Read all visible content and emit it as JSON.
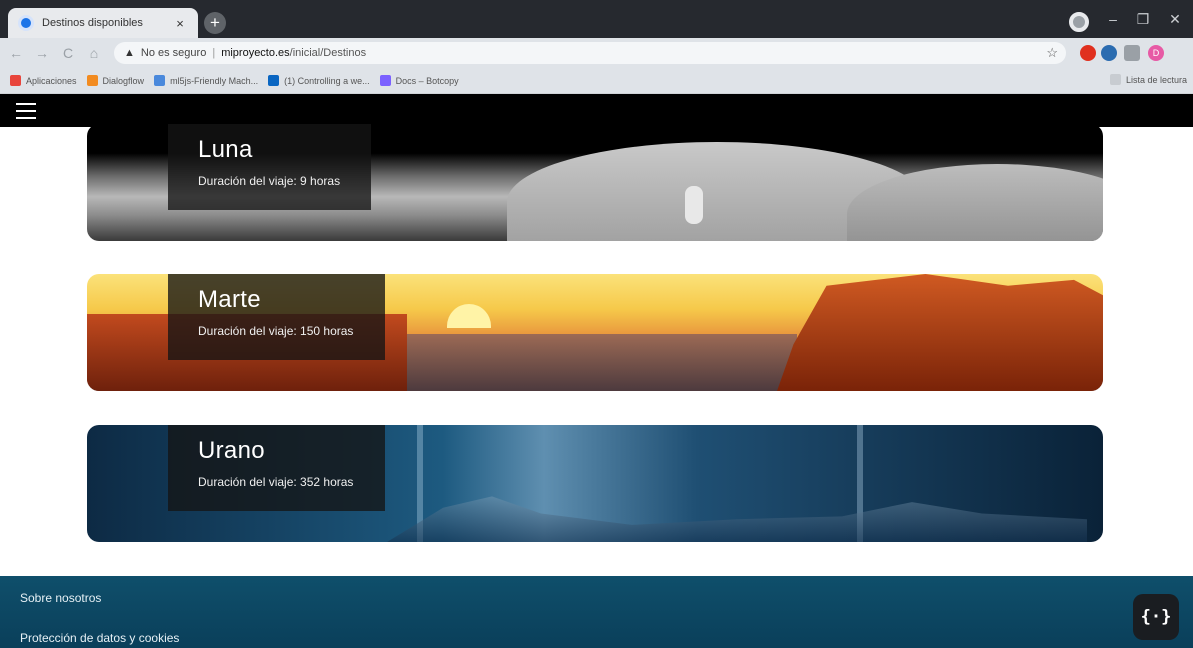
{
  "browser": {
    "tab_title": "Destinos disponibles",
    "tab_close": "×",
    "new_tab": "+",
    "nav": {
      "back": "←",
      "forward": "→",
      "reload": "C",
      "home": "⌂"
    },
    "security_label": "No es seguro",
    "url_host": "miproyecto.es",
    "url_path": "/inicial/Destinos",
    "bookmarks": [
      {
        "label": "Aplicaciones",
        "color": "#e8453c"
      },
      {
        "label": "Dialogflow",
        "color": "#f28b20"
      },
      {
        "label": "ml5js-Friendly Mach...",
        "color": "#4a89dc"
      },
      {
        "label": "(1) Controlling a we...",
        "color": "#0a66c2"
      },
      {
        "label": "Docs – Botcopy",
        "color": "#7b61ff"
      }
    ],
    "reading_list": "Lista de lectura",
    "window_controls": {
      "minimize": "–",
      "maximize": "❐",
      "close": "✕"
    },
    "profile_initial": "D"
  },
  "page": {
    "destinations": [
      {
        "name": "Luna",
        "duration": "Duración del viaje: 9 horas"
      },
      {
        "name": "Marte",
        "duration": "Duración del viaje: 150 horas"
      },
      {
        "name": "Urano",
        "duration": "Duración del viaje: 352 horas"
      }
    ],
    "footer": {
      "about": "Sobre nosotros",
      "privacy": "Protección de datos y cookies"
    },
    "badge": "{·}"
  }
}
